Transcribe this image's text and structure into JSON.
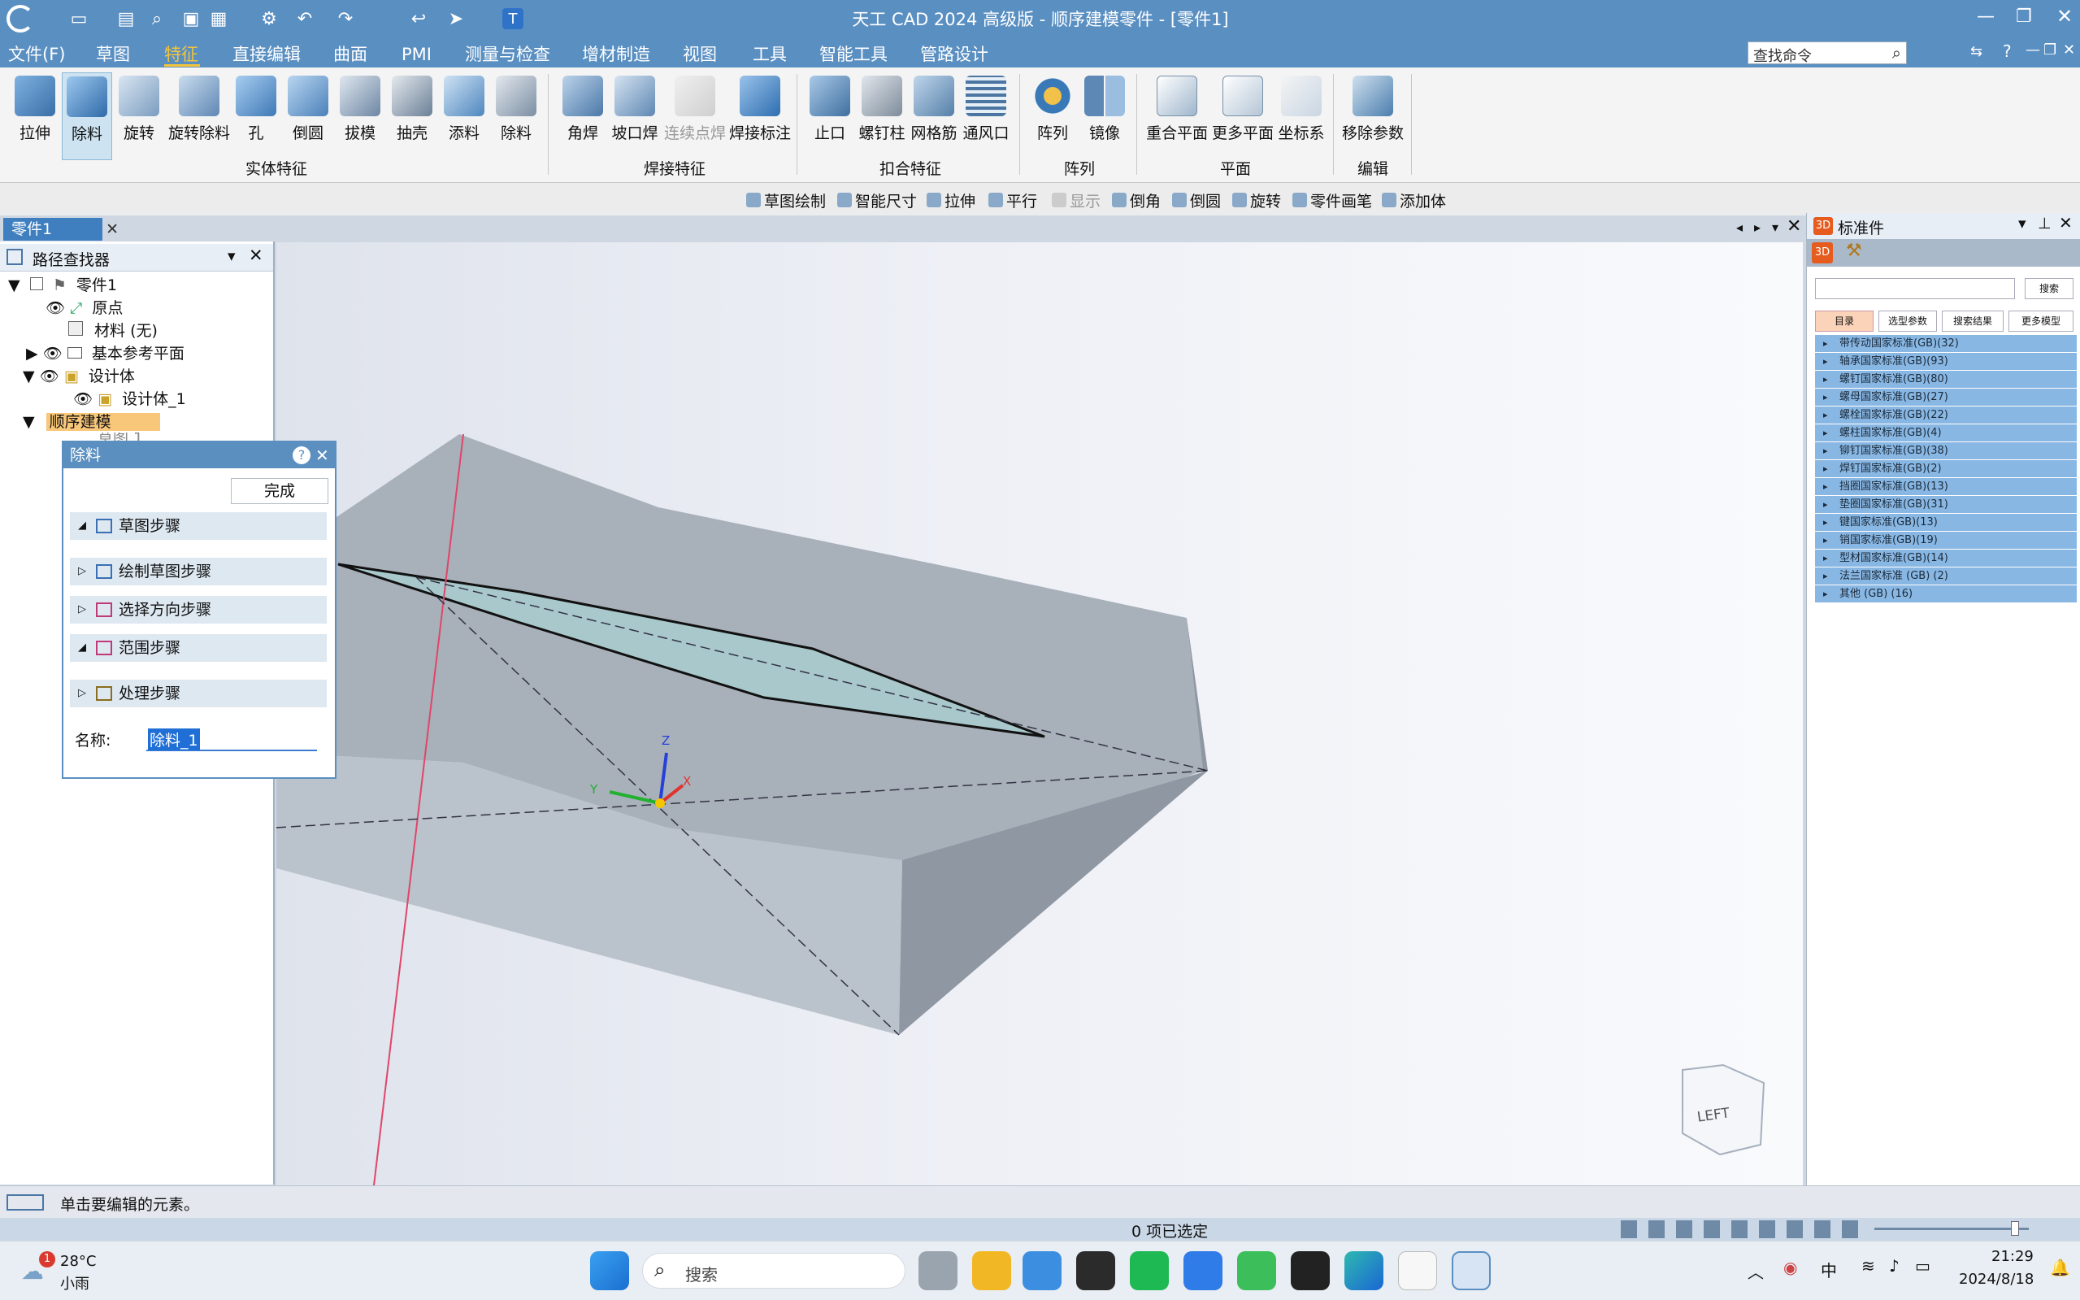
{
  "window": {
    "title": "天工 CAD 2024 高级版 - 顺序建模零件 - [零件1]"
  },
  "menu": {
    "file": "文件(F)",
    "items": [
      "草图",
      "特征",
      "直接编辑",
      "曲面",
      "PMI",
      "测量与检查",
      "增材制造",
      "视图",
      "工具",
      "智能工具",
      "管路设计"
    ],
    "active_index": 1,
    "search_placeholder": "查找命令"
  },
  "ribbon": {
    "buttons": [
      "拉伸",
      "除料",
      "旋转",
      "旋转除料",
      "孔",
      "倒圆",
      "拔模",
      "抽壳",
      "添料",
      "除料",
      "角焊",
      "坡口焊",
      "连续点焊",
      "焊接标注",
      "止口",
      "螺钉柱",
      "网格筋",
      "通风口",
      "阵列",
      "镜像",
      "重合平面",
      "更多平面",
      "坐标系",
      "移除参数"
    ],
    "groups": [
      "实体特征",
      "焊接特征",
      "扣合特征",
      "阵列",
      "平面",
      "编辑"
    ]
  },
  "minibar": [
    "草图绘制",
    "智能尺寸",
    "拉伸",
    "平行",
    "显示",
    "倒角",
    "倒圆",
    "旋转",
    "零件画笔",
    "添加体"
  ],
  "doc_tab": "零件1",
  "pathfinder": {
    "title": "路径查找器",
    "items": [
      {
        "label": "零件1"
      },
      {
        "label": "原点"
      },
      {
        "label": "材料 (无)"
      },
      {
        "label": "基本参考平面"
      },
      {
        "label": "设计体"
      },
      {
        "label": "设计体_1"
      },
      {
        "label": "顺序建模"
      },
      {
        "label": "草图 1"
      }
    ]
  },
  "dialog": {
    "title": "除料",
    "done": "完成",
    "steps": [
      "草图步骤",
      "绘制草图步骤",
      "选择方向步骤",
      "范围步骤",
      "处理步骤"
    ],
    "name_label": "名称:",
    "name_value": "除料_1"
  },
  "viewport": {
    "triad": {
      "x": "X",
      "y": "Y",
      "z": "Z"
    },
    "viewcube_label": "LEFT"
  },
  "right_panel": {
    "title": "标准件",
    "search_button": "搜索",
    "tabs": [
      "目录",
      "选型参数",
      "搜索结果",
      "更多模型"
    ],
    "categories": [
      "带传动国家标准(GB)(32)",
      "轴承国家标准(GB)(93)",
      "螺钉国家标准(GB)(80)",
      "螺母国家标准(GB)(27)",
      "螺栓国家标准(GB)(22)",
      "螺柱国家标准(GB)(4)",
      "铆钉国家标准(GB)(38)",
      "焊钉国家标准(GB)(2)",
      "挡圈国家标准(GB)(13)",
      "垫圈国家标准(GB)(31)",
      "键国家标准(GB)(13)",
      "销国家标准(GB)(19)",
      "型材国家标准(GB)(14)",
      "法兰国家标准 (GB) (2)",
      "其他 (GB) (16)"
    ]
  },
  "status": {
    "prompt": "单击要编辑的元素。",
    "selection": "0 项已选定"
  },
  "taskbar": {
    "weather_temp": "28°C",
    "weather_desc": "小雨",
    "badge": "1",
    "search": "搜索",
    "ime": "中",
    "time": "21:29",
    "date": "2024/8/18"
  }
}
